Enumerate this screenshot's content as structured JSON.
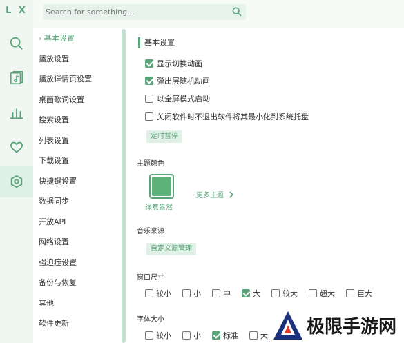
{
  "app": {
    "logo": "L X"
  },
  "search": {
    "placeholder": "Search for something..."
  },
  "rail": [
    "search-icon",
    "music-file-icon",
    "bar-chart-icon",
    "heart-icon",
    "settings-icon"
  ],
  "subnav": {
    "items": [
      {
        "label": "› 基本设置",
        "active": true
      },
      {
        "label": "播放设置"
      },
      {
        "label": "播放详情页设置"
      },
      {
        "label": "桌面歌词设置"
      },
      {
        "label": "搜索设置"
      },
      {
        "label": "列表设置"
      },
      {
        "label": "下载设置"
      },
      {
        "label": "快捷键设置"
      },
      {
        "label": "数据同步"
      },
      {
        "label": "开放API"
      },
      {
        "label": "网络设置"
      },
      {
        "label": "强迫症设置"
      },
      {
        "label": "备份与恢复"
      },
      {
        "label": "其他"
      },
      {
        "label": "软件更新"
      }
    ]
  },
  "basic": {
    "title": "基本设置",
    "options": [
      {
        "label": "显示切换动画",
        "checked": true
      },
      {
        "label": "弹出层随机动画",
        "checked": true
      },
      {
        "label": "以全屏模式启动",
        "checked": false
      },
      {
        "label": "关闭软件时不退出软件将其最小化到系统托盘",
        "checked": false
      }
    ],
    "timer_button": "定时暂停"
  },
  "theme": {
    "title": "主题颜色",
    "current_name": "绿意盎然",
    "current_color": "#5cb37a",
    "more_label": "更多主题"
  },
  "music_source": {
    "title": "音乐来源",
    "manage_button": "自定义源管理"
  },
  "window_size": {
    "title": "窗口尺寸",
    "options": [
      {
        "label": "较小",
        "checked": false
      },
      {
        "label": "小",
        "checked": false
      },
      {
        "label": "中",
        "checked": false
      },
      {
        "label": "大",
        "checked": true
      },
      {
        "label": "较大",
        "checked": false
      },
      {
        "label": "超大",
        "checked": false
      },
      {
        "label": "巨大",
        "checked": false
      }
    ]
  },
  "font_size": {
    "title": "字体大小",
    "options": [
      {
        "label": "较小",
        "checked": false
      },
      {
        "label": "小",
        "checked": false
      },
      {
        "label": "标准",
        "checked": true
      },
      {
        "label": "大",
        "checked": false
      }
    ]
  },
  "watermark": {
    "text": "极限手游网"
  },
  "colors": {
    "accent": "#5aa47a",
    "rail_bg": "#f0f7f3",
    "rail_active": "#dff0e6"
  }
}
